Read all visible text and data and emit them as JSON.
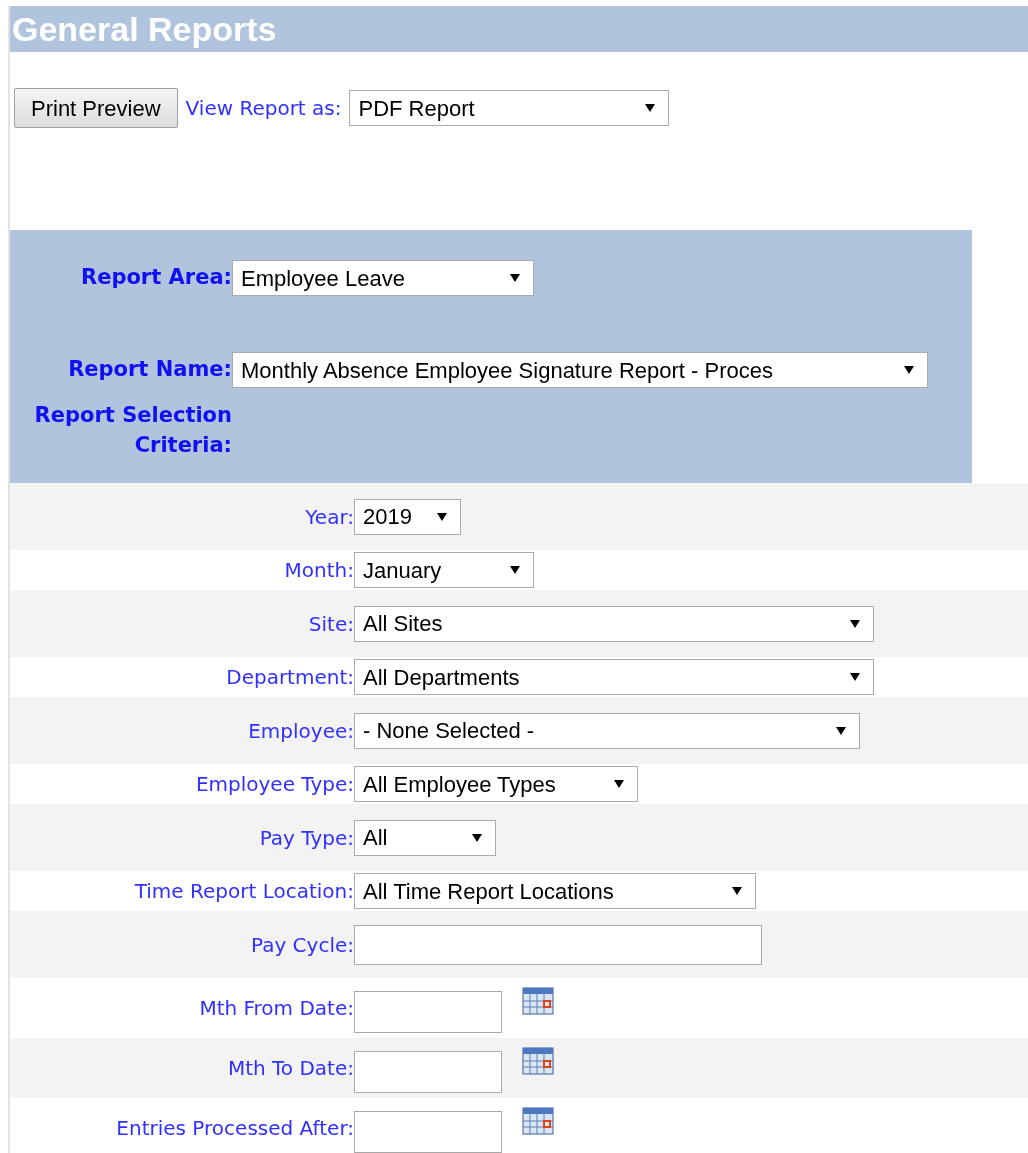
{
  "header": {
    "title": "General Reports"
  },
  "toolbar": {
    "print_button": "Print Preview",
    "view_label": "View Report as:",
    "view_select": "PDF Report"
  },
  "report_panel": {
    "area_label": "Report Area:",
    "area_select": "Employee Leave",
    "name_label": "Report Name:",
    "name_select": "Monthly Absence Employee Signature Report - Proces",
    "criteria_label": "Report Selection Criteria:"
  },
  "criteria": [
    {
      "label": "Year:",
      "kind": "select",
      "value": "2019"
    },
    {
      "label": "Month:",
      "kind": "select",
      "value": "January"
    },
    {
      "label": "Site:",
      "kind": "select",
      "value": "All Sites"
    },
    {
      "label": "Department:",
      "kind": "select",
      "value": "All Departments"
    },
    {
      "label": "Employee:",
      "kind": "select",
      "value": "- None Selected -"
    },
    {
      "label": "Employee Type:",
      "kind": "select",
      "value": "All Employee Types"
    },
    {
      "label": "Pay Type:",
      "kind": "select",
      "value": "All"
    },
    {
      "label": "Time Report Location:",
      "kind": "select",
      "value": "All Time Report Locations"
    },
    {
      "label": "Pay Cycle:",
      "kind": "text"
    },
    {
      "label": "Mth From Date:",
      "kind": "date"
    },
    {
      "label": "Mth To Date:",
      "kind": "date"
    },
    {
      "label": "Entries Processed After:",
      "kind": "date"
    }
  ]
}
